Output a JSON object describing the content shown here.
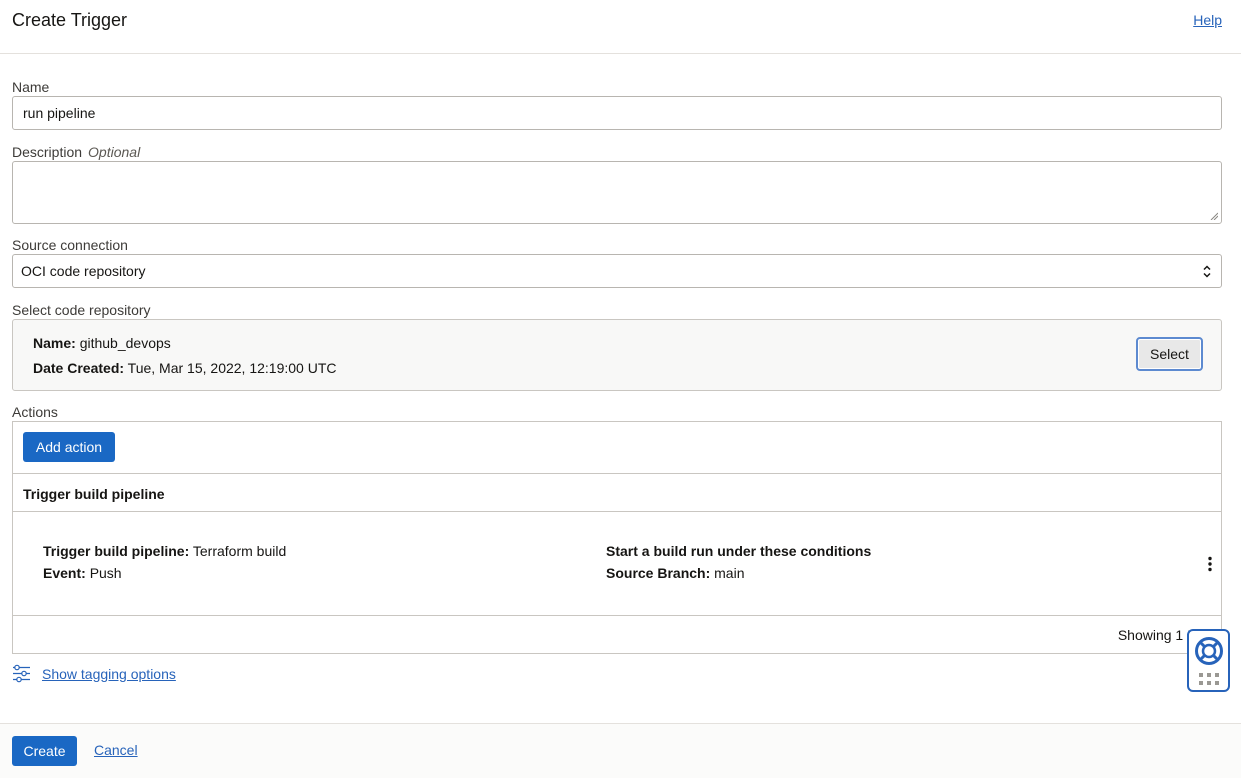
{
  "header": {
    "title": "Create Trigger",
    "help_label": "Help"
  },
  "form": {
    "name_label": "Name",
    "name_value": "run pipeline",
    "description_label": "Description",
    "description_optional": "Optional",
    "source_label": "Source connection",
    "source_value": "OCI code repository",
    "repo_label": "Select code repository",
    "repo": {
      "name_key": "Name:",
      "name_value": "github_devops",
      "date_key": "Date Created:",
      "date_value": "Tue, Mar 15, 2022, 12:19:00 UTC",
      "select_label": "Select"
    },
    "actions_label": "Actions"
  },
  "actions": {
    "add_label": "Add action",
    "column_header": "Trigger build pipeline",
    "rows": [
      {
        "pipeline_key": "Trigger build pipeline:",
        "pipeline_value": "Terraform build",
        "event_key": "Event:",
        "event_value": "Push",
        "conditions_title": "Start a build run under these conditions",
        "branch_key": "Source Branch:",
        "branch_value": "main"
      }
    ],
    "footer": "Showing 1 I"
  },
  "tagging": {
    "label": "Show tagging options",
    "icon": "sliders-icon"
  },
  "footer": {
    "create_label": "Create",
    "cancel_label": "Cancel"
  },
  "colors": {
    "primary": "#1a68c4",
    "link": "#2763ba",
    "border": "#c9c6c1"
  }
}
